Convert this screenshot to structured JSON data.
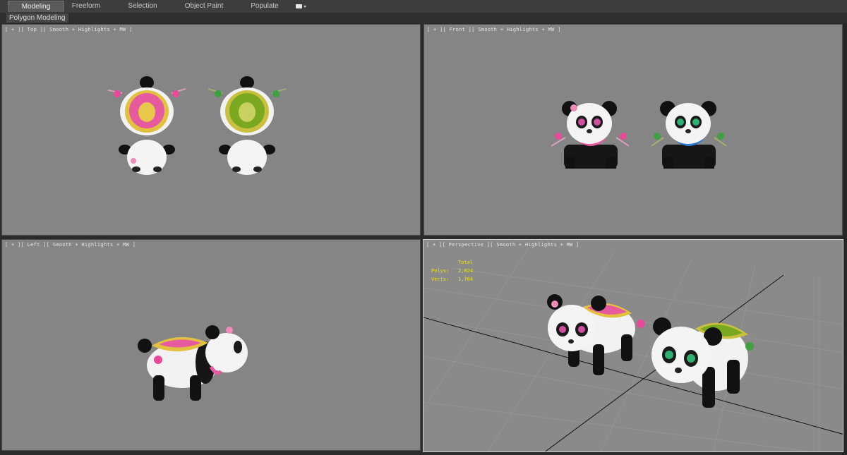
{
  "ribbon": {
    "tabs": [
      {
        "label": "Modeling",
        "active": true
      },
      {
        "label": "Freeform",
        "active": false
      },
      {
        "label": "Selection",
        "active": false
      },
      {
        "label": "Object Paint",
        "active": false
      },
      {
        "label": "Populate",
        "active": false
      }
    ],
    "options_icon": "ribbon-options-icon"
  },
  "subribbon": {
    "label": "Polygon Modeling"
  },
  "viewports": {
    "top": {
      "label": "[ + ][ Top ][ Smooth + Highlights + MW ]"
    },
    "front": {
      "label": "[ + ][ Front ][ Smooth + Highlights + MW ]"
    },
    "left": {
      "label": "[ + ][ Left ][ Smooth + Highlights + MW ]"
    },
    "perspective": {
      "label": "[ + ][ Perspective ][ Smooth + Highlights + MW ]",
      "stats": {
        "header": "Total",
        "polys_label": "Polys:",
        "polys_value": "2,024",
        "verts_label": "Verts:",
        "verts_value": "1,704"
      }
    }
  },
  "colors": {
    "viewport_bg": "#858585",
    "active_border": "#d0d0d0",
    "stats_text": "#e8e020",
    "pink_saddle": "#e85aa0",
    "green_saddle": "#7aa820",
    "gold_trim": "#e2c040"
  }
}
